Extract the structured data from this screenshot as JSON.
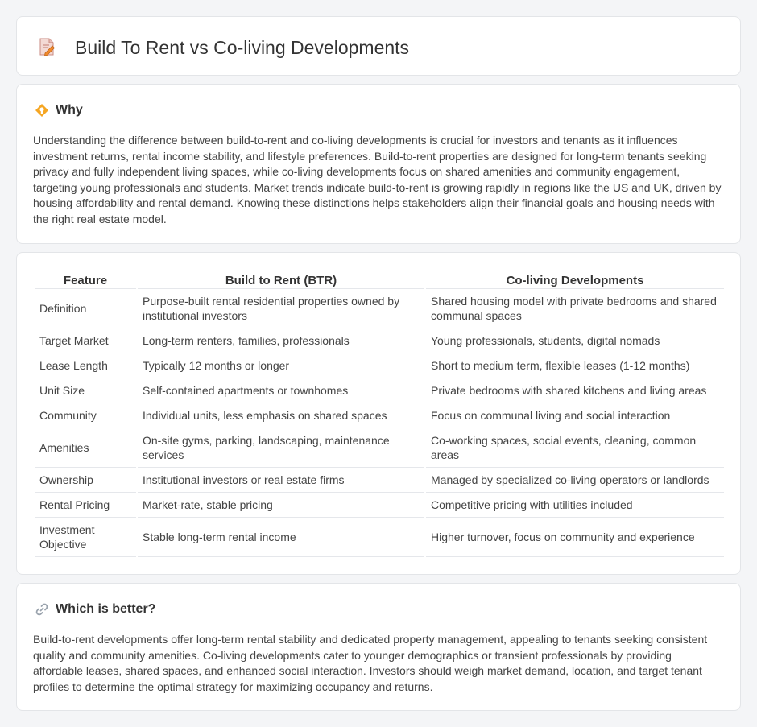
{
  "header": {
    "title": "Build To Rent vs Co-living Developments",
    "icon": "document-pen-icon"
  },
  "why": {
    "title": "Why",
    "icon": "lightbulb-diamond-icon",
    "text": "Understanding the difference between build-to-rent and co-living developments is crucial for investors and tenants as it influences investment returns, rental income stability, and lifestyle preferences. Build-to-rent properties are designed for long-term tenants seeking privacy and fully independent living spaces, while co-living developments focus on shared amenities and community engagement, targeting young professionals and students. Market trends indicate build-to-rent is growing rapidly in regions like the US and UK, driven by housing affordability and rental demand. Knowing these distinctions helps stakeholders align their financial goals and housing needs with the right real estate model."
  },
  "table": {
    "headers": [
      "Feature",
      "Build to Rent (BTR)",
      "Co-living Developments"
    ],
    "rows": [
      {
        "feature": "Definition",
        "btr": "Purpose-built rental residential properties owned by institutional investors",
        "coliving": "Shared housing model with private bedrooms and shared communal spaces"
      },
      {
        "feature": "Target Market",
        "btr": "Long-term renters, families, professionals",
        "coliving": "Young professionals, students, digital nomads"
      },
      {
        "feature": "Lease Length",
        "btr": "Typically 12 months or longer",
        "coliving": "Short to medium term, flexible leases (1-12 months)"
      },
      {
        "feature": "Unit Size",
        "btr": "Self-contained apartments or townhomes",
        "coliving": "Private bedrooms with shared kitchens and living areas"
      },
      {
        "feature": "Community",
        "btr": "Individual units, less emphasis on shared spaces",
        "coliving": "Focus on communal living and social interaction"
      },
      {
        "feature": "Amenities",
        "btr": "On-site gyms, parking, landscaping, maintenance services",
        "coliving": "Co-working spaces, social events, cleaning, common areas"
      },
      {
        "feature": "Ownership",
        "btr": "Institutional investors or real estate firms",
        "coliving": "Managed by specialized co-living operators or landlords"
      },
      {
        "feature": "Rental Pricing",
        "btr": "Market-rate, stable pricing",
        "coliving": "Competitive pricing with utilities included"
      },
      {
        "feature": "Investment Objective",
        "btr": "Stable long-term rental income",
        "coliving": "Higher turnover, focus on community and experience"
      }
    ]
  },
  "better": {
    "title": "Which is better?",
    "icon": "link-icon",
    "text": "Build-to-rent developments offer long-term rental stability and dedicated property management, appealing to tenants seeking consistent quality and community amenities. Co-living developments cater to younger demographics or transient professionals by providing affordable leases, shared spaces, and enhanced social interaction. Investors should weigh market demand, location, and target tenant profiles to determine the optimal strategy for maximizing occupancy and returns."
  }
}
